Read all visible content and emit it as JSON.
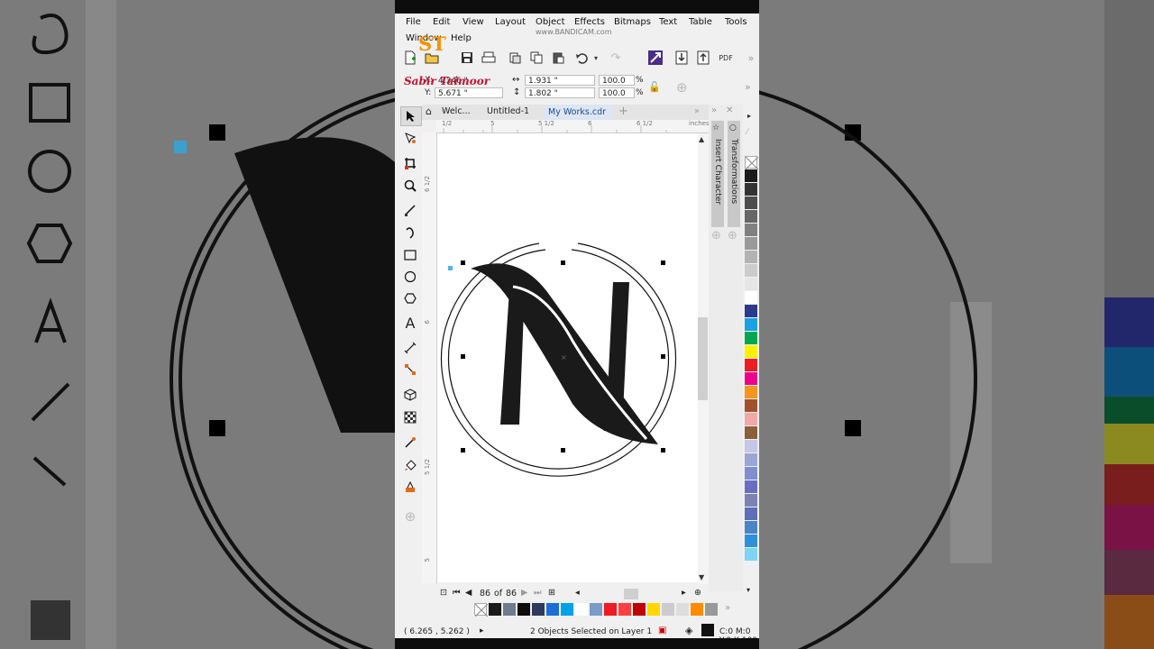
{
  "menu": {
    "row1": [
      "File",
      "Edit",
      "View",
      "Layout",
      "Object",
      "Effects",
      "Bitmaps",
      "Text",
      "Table",
      "Tools"
    ],
    "row2": [
      "Window",
      "Help"
    ]
  },
  "watermark": {
    "logo": "ST",
    "name": "Sabir Taimoor",
    "recorder": "www.BANDICAM.com"
  },
  "toolbar": {
    "publish_label": "PDF"
  },
  "property_bar": {
    "x_value": "4.346 \"",
    "y_value": "5.671 \"",
    "x_label": "X:",
    "y_label": "Y:",
    "width_value": "1.931 \"",
    "height_value": "1.802 \"",
    "scale_x": "100.0",
    "scale_y": "100.0",
    "percent": "%"
  },
  "tabs": [
    {
      "label": "Welc..."
    },
    {
      "label": "Untitled-1"
    },
    {
      "label": "My Works.cdr"
    }
  ],
  "ruler": {
    "top_labels": [
      "1/2",
      "5",
      "5 1/2",
      "6",
      "6 1/2",
      "7"
    ],
    "unit": "inches",
    "left_labels": [
      "6 1/2",
      "6",
      "5 1/2",
      "5"
    ]
  },
  "dockers": {
    "insert_character": "Insert Character",
    "transformations": "Transformations"
  },
  "page_nav": {
    "current": "86",
    "of": "of",
    "total": "86"
  },
  "status": {
    "coordinates": "( 6.265 , 5.262 )",
    "selection": "2 Objects Selected on Layer 1",
    "color_info": "C:0 M:0 Y:0 K:100"
  },
  "colors": {
    "vertical_palette": [
      "#ffffff",
      "#1a1a1a",
      "#333333",
      "#4d4d4d",
      "#666666",
      "#808080",
      "#999999",
      "#b3b3b3",
      "#cccccc",
      "#e6e6e6",
      "#ffffff",
      "#2b3a8c",
      "#1ba1e2",
      "#00a651",
      "#fff200",
      "#ed1c24",
      "#ec008c",
      "#f7941d",
      "#a0522d",
      "#f4a7a7",
      "#8b5e3c",
      "#c6c6e6",
      "#9aa6d6",
      "#7f8fd0",
      "#6a6fc2",
      "#7b83b5",
      "#5d6fb8",
      "#4c84c8",
      "#2e90d8",
      "#7fd4f5"
    ],
    "horizontal_palette": [
      "#ffffff",
      "#1a1a1a",
      "#6d7c8f",
      "#0d0d0d",
      "#2e3a5c",
      "#1d6fd6",
      "#00a2e8",
      "#ffffff",
      "#7a9cc6",
      "#ed1c24",
      "#ff4040",
      "#c00000",
      "#ffd700",
      "#cccccc",
      "#dddddd",
      "#ff8c00",
      "#999999"
    ]
  },
  "logo_letter": "N"
}
